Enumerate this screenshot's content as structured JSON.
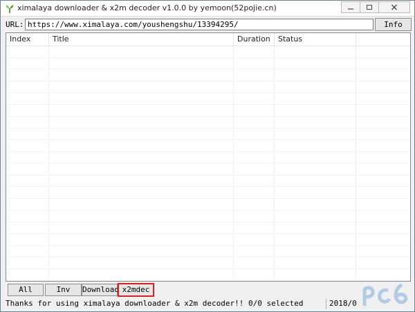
{
  "window": {
    "title": "ximalaya downloader & x2m decoder v1.0.0 by yemoon(52pojie.cn)",
    "icon": "ximalaya-leaf-icon"
  },
  "url": {
    "label": "URL:",
    "value": "https://www.ximalaya.com/youshengshu/13394295/",
    "info_button": "Info"
  },
  "table": {
    "columns": [
      "Index",
      "Title",
      "Duration",
      "Status"
    ],
    "rows": []
  },
  "buttons": {
    "all": "All",
    "inv": "Inv",
    "download": "Download",
    "x2mdec": "x2mdec"
  },
  "status": {
    "message": "Thanks for using ximalaya downloader & x2m decoder!! 0/0 selected",
    "right": "2018/0"
  },
  "colors": {
    "highlight_border": "#d9201f",
    "watermark": "#9dbfe0"
  }
}
